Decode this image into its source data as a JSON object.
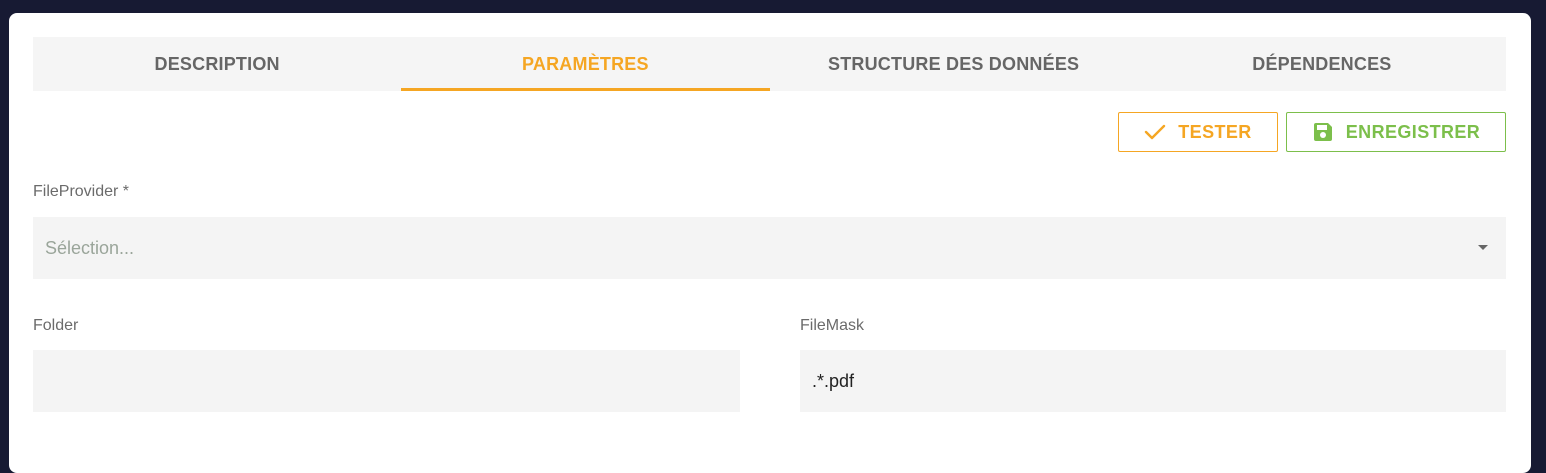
{
  "tabs": [
    {
      "label": "DESCRIPTION",
      "active": false
    },
    {
      "label": "PARAMÈTRES",
      "active": true
    },
    {
      "label": "STRUCTURE DES DONNÉES",
      "active": false
    },
    {
      "label": "DÉPENDENCES",
      "active": false
    }
  ],
  "toolbar": {
    "test_label": "TESTER",
    "test_icon": "check-icon",
    "save_label": "ENREGISTRER",
    "save_icon": "floppy-disk-icon"
  },
  "form": {
    "file_provider": {
      "label": "FileProvider *",
      "placeholder": "Sélection...",
      "value": ""
    },
    "folder": {
      "label": "Folder",
      "value": ""
    },
    "file_mask": {
      "label": "FileMask",
      "value": ".*.pdf"
    }
  },
  "colors": {
    "accent": "#f5a623",
    "save": "#7cbf4b",
    "background": "#171a33",
    "field_bg": "#f4f4f4",
    "tab_bar_bg": "#f5f5f5"
  }
}
